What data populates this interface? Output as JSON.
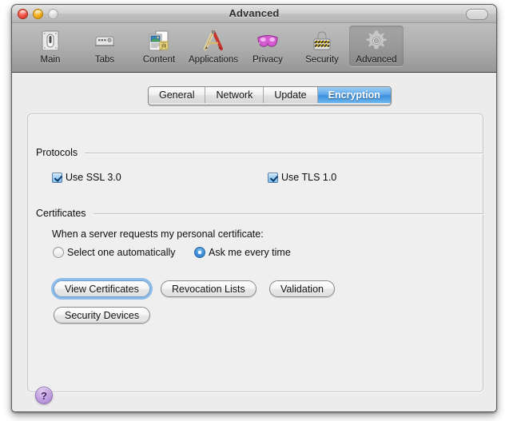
{
  "window": {
    "title": "Advanced",
    "controls": {
      "close": "close",
      "minimize": "minimize",
      "zoom": "zoom",
      "toolbar_toggle": "toolbar-toggle"
    }
  },
  "toolbar": {
    "items": [
      {
        "label": "Main",
        "icon": "toggle-switch-icon",
        "selected": false
      },
      {
        "label": "Tabs",
        "icon": "tabs-icon",
        "selected": false
      },
      {
        "label": "Content",
        "icon": "content-pages-icon",
        "selected": false
      },
      {
        "label": "Applications",
        "icon": "drafting-tools-icon",
        "selected": false
      },
      {
        "label": "Privacy",
        "icon": "mask-icon",
        "selected": false
      },
      {
        "label": "Security",
        "icon": "padlock-icon",
        "selected": false
      },
      {
        "label": "Advanced",
        "icon": "gear-icon",
        "selected": true
      }
    ]
  },
  "tabs": [
    {
      "label": "General",
      "active": false
    },
    {
      "label": "Network",
      "active": false
    },
    {
      "label": "Update",
      "active": false
    },
    {
      "label": "Encryption",
      "active": true
    }
  ],
  "protocols": {
    "heading": "Protocols",
    "ssl": {
      "label": "Use SSL 3.0",
      "checked": true
    },
    "tls": {
      "label": "Use TLS 1.0",
      "checked": true
    }
  },
  "certificates": {
    "heading": "Certificates",
    "prompt": "When a server requests my personal certificate:",
    "options": [
      {
        "label": "Select one automatically",
        "selected": false
      },
      {
        "label": "Ask me every time",
        "selected": true
      }
    ],
    "buttons": [
      {
        "label": "View Certificates",
        "focused": true
      },
      {
        "label": "Revocation Lists",
        "focused": false
      },
      {
        "label": "Validation",
        "focused": false
      },
      {
        "label": "Security Devices",
        "focused": false
      }
    ]
  },
  "help": {
    "label": "?"
  },
  "colors": {
    "accent_blue": "#3c8fdd",
    "focus_ring": "#6aa8e6",
    "window_bg": "#ececec",
    "toolbar_top": "#bdbdbd",
    "toolbar_bottom": "#969696"
  }
}
